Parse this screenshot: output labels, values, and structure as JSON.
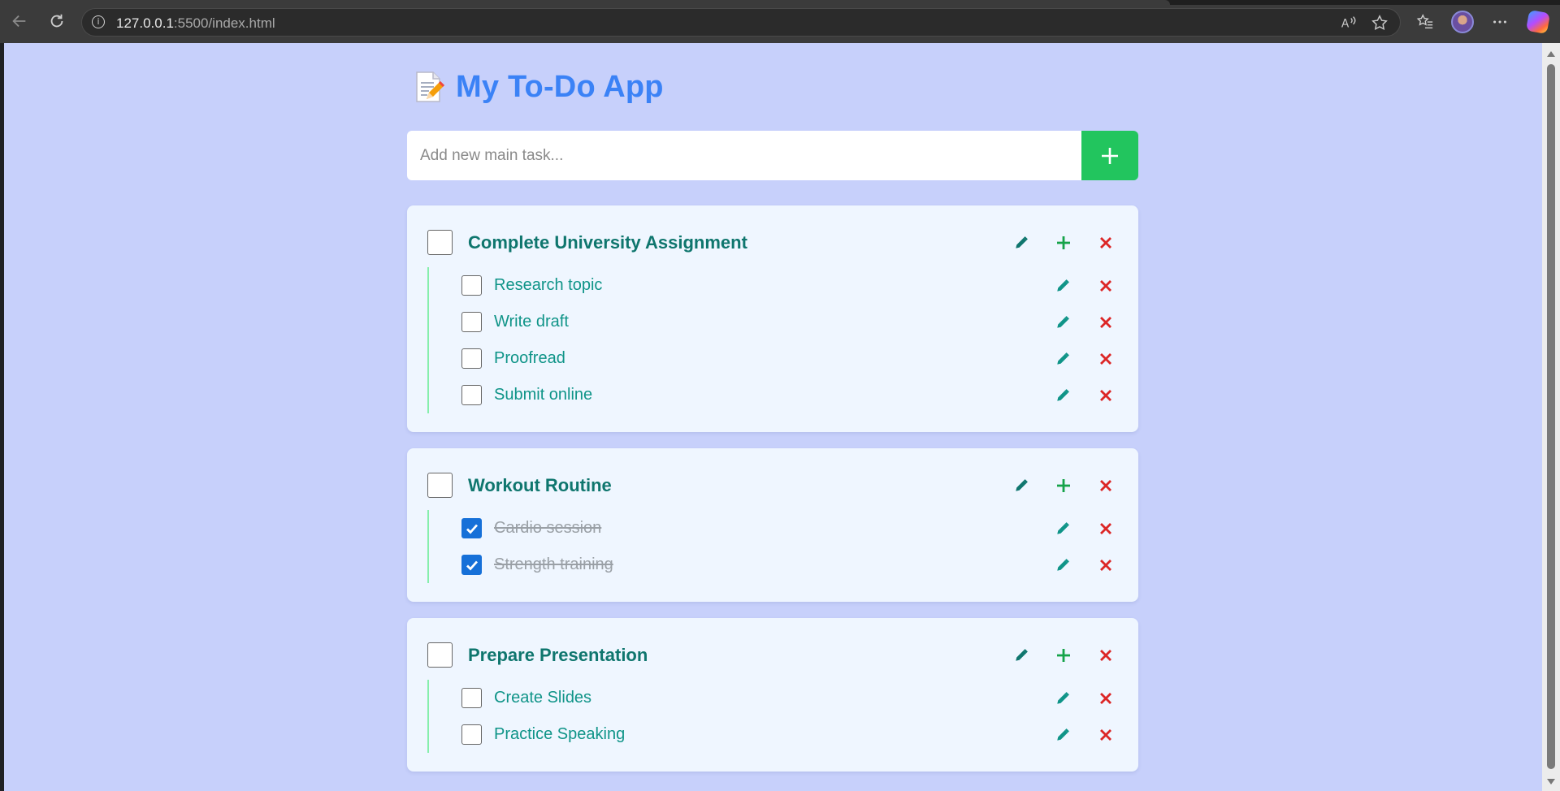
{
  "browser": {
    "url_host": "127.0.0.1",
    "url_rest": ":5500/index.html"
  },
  "app": {
    "title": "My To-Do App",
    "title_icon": "memo-icon",
    "accent": "#3b82f6",
    "add_input": {
      "placeholder": "Add new main task...",
      "value": ""
    },
    "add_button_icon": "plus-icon"
  },
  "tasks": [
    {
      "title": "Complete University Assignment",
      "checked": false,
      "subtasks": [
        {
          "title": "Research topic",
          "checked": false
        },
        {
          "title": "Write draft",
          "checked": false
        },
        {
          "title": "Proofread",
          "checked": false
        },
        {
          "title": "Submit online",
          "checked": false
        }
      ]
    },
    {
      "title": "Workout Routine",
      "checked": false,
      "subtasks": [
        {
          "title": "Cardio session",
          "checked": true
        },
        {
          "title": "Strength training",
          "checked": true
        }
      ]
    },
    {
      "title": "Prepare Presentation",
      "checked": false,
      "subtasks": [
        {
          "title": "Create Slides",
          "checked": false
        },
        {
          "title": "Practice Speaking",
          "checked": false
        }
      ]
    }
  ],
  "icons": {
    "edit": "pencil-icon",
    "add_subtask": "plus-icon",
    "delete": "close-icon"
  },
  "colors": {
    "page_bg": "#c7d0fb",
    "card_bg": "#eff6ff",
    "add_button": "#22c55e",
    "title_text": "#0f766e",
    "edit_icon": "#0f766e",
    "plus_icon": "#16a34a",
    "delete_icon": "#dc2626",
    "done_text": "#9aa0a6"
  }
}
